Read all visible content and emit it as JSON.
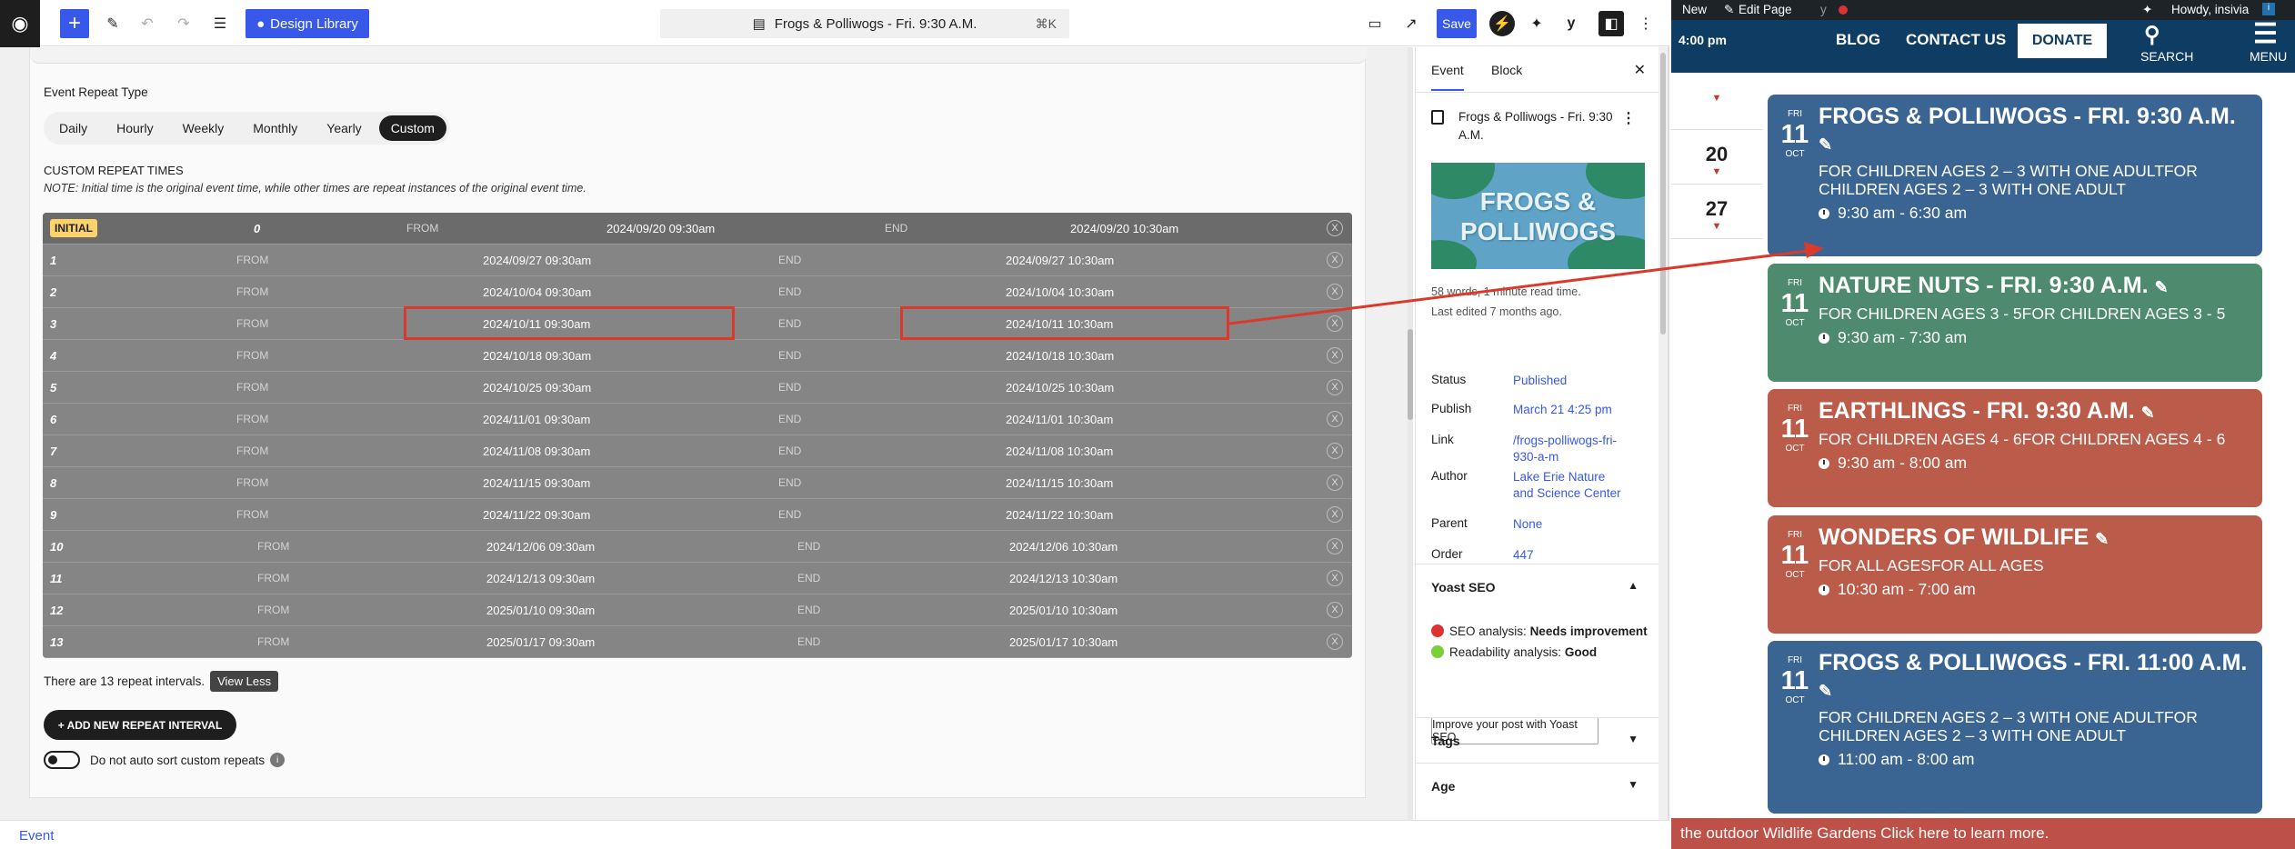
{
  "editor": {
    "design_library": "Design Library",
    "doc_title": "Frogs & Polliwogs - Fri. 9:30 A.M.",
    "doc_shortcut": "⌘K",
    "save_label": "Save",
    "breadcrumb": "Event"
  },
  "repeat": {
    "type_label": "Event Repeat Type",
    "types": [
      "Daily",
      "Hourly",
      "Weekly",
      "Monthly",
      "Yearly",
      "Custom"
    ],
    "active_type": "Custom",
    "custom_heading": "CUSTOM REPEAT TIMES",
    "note": "NOTE: Initial time is the original event time, while other times are repeat instances of the original event time.",
    "from_label": "FROM",
    "end_label": "END",
    "remove_label": "X",
    "initial": {
      "badge": "INITIAL",
      "num": "0",
      "from": "2024/09/20 09:30am",
      "end": "2024/09/20 10:30am"
    },
    "rows": [
      {
        "num": "1",
        "from": "2024/09/27 09:30am",
        "end": "2024/09/27 10:30am"
      },
      {
        "num": "2",
        "from": "2024/10/04 09:30am",
        "end": "2024/10/04 10:30am"
      },
      {
        "num": "3",
        "from": "2024/10/11 09:30am",
        "end": "2024/10/11 10:30am"
      },
      {
        "num": "4",
        "from": "2024/10/18 09:30am",
        "end": "2024/10/18 10:30am"
      },
      {
        "num": "5",
        "from": "2024/10/25 09:30am",
        "end": "2024/10/25 10:30am"
      },
      {
        "num": "6",
        "from": "2024/11/01 09:30am",
        "end": "2024/11/01 10:30am"
      },
      {
        "num": "7",
        "from": "2024/11/08 09:30am",
        "end": "2024/11/08 10:30am"
      },
      {
        "num": "8",
        "from": "2024/11/15 09:30am",
        "end": "2024/11/15 10:30am"
      },
      {
        "num": "9",
        "from": "2024/11/22 09:30am",
        "end": "2024/11/22 10:30am"
      },
      {
        "num": "10",
        "from": "2024/12/06 09:30am",
        "end": "2024/12/06 10:30am"
      },
      {
        "num": "11",
        "from": "2024/12/13 09:30am",
        "end": "2024/12/13 10:30am"
      },
      {
        "num": "12",
        "from": "2025/01/10 09:30am",
        "end": "2025/01/10 10:30am"
      },
      {
        "num": "13",
        "from": "2025/01/17 09:30am",
        "end": "2025/01/17 10:30am"
      }
    ],
    "count_text": "There are 13 repeat intervals.",
    "view_less": "View Less",
    "add_interval": "+ ADD NEW REPEAT INTERVAL",
    "no_sort_label": "Do not auto sort custom repeats",
    "info_glyph": "i",
    "highlight_color": "#d93a2b"
  },
  "sidebar": {
    "tab_event": "Event",
    "tab_block": "Block",
    "post_title": "Frogs & Polliwogs - Fri. 9:30 A.M.",
    "image_text": "FROGS & POLLIWOGS",
    "meta_words": "58 words, 1 minute read time.",
    "meta_edited": "Last edited 7 months ago.",
    "fields": [
      {
        "key": "Status",
        "value": "Published"
      },
      {
        "key": "Publish",
        "value": "March 21 4:25 pm"
      },
      {
        "key": "Link",
        "value": "/frogs-polliwogs-fri-930-a-m"
      },
      {
        "key": "Author",
        "value": "Lake Erie Nature and Science Center"
      },
      {
        "key": "Parent",
        "value": "None"
      },
      {
        "key": "Order",
        "value": "447"
      }
    ],
    "yoast_title": "Yoast SEO",
    "seo_label": "SEO analysis:",
    "seo_value": "Needs improvement",
    "read_label": "Readability analysis:",
    "read_value": "Good",
    "yoast_button": "Improve your post with Yoast SEO",
    "tags_title": "Tags",
    "age_title": "Age"
  },
  "site": {
    "admin_new": "New",
    "admin_edit": "Edit Page",
    "admin_howdy": "Howdy, insivia",
    "time_label": "4:00 pm",
    "nav": {
      "blog": "BLOG",
      "contact": "CONTACT US",
      "donate": "DONATE",
      "search": "SEARCH",
      "menu": "MENU"
    },
    "days": [
      "20",
      "27"
    ],
    "events": [
      {
        "dw": "FRI",
        "dn": "11",
        "dm": "OCT",
        "title": "Frogs & Polliwogs - Fri. 9:30 A.M.",
        "desc": "For children ages 2 – 3 with one adultFor children ages 2 – 3 with one adult",
        "time": "9:30 am - 6:30 am",
        "color": "#3a6491"
      },
      {
        "dw": "FRI",
        "dn": "11",
        "dm": "OCT",
        "title": "Nature Nuts - Fri. 9:30 A.M.",
        "desc": "For children ages 3 - 5For children ages 3 - 5",
        "time": "9:30 am - 7:30 am",
        "color": "#4e8a6d"
      },
      {
        "dw": "FRI",
        "dn": "11",
        "dm": "OCT",
        "title": "Earthlings - Fri. 9:30 A.M.",
        "desc": "For children ages 4 - 6For children ages 4 - 6",
        "time": "9:30 am - 8:00 am",
        "color": "#bb5b4a"
      },
      {
        "dw": "FRI",
        "dn": "11",
        "dm": "OCT",
        "title": "Wonders of Wildlife",
        "desc": "For all agesFor all ages",
        "time": "10:30 am - 7:00 am",
        "color": "#bb5b4a"
      },
      {
        "dw": "FRI",
        "dn": "11",
        "dm": "OCT",
        "title": "Frogs & Polliwogs - Fri. 11:00 A.M.",
        "desc": "For children ages 2 – 3 with one adultFor children ages 2 – 3 with one adult",
        "time": "11:00 am - 8:00 am",
        "color": "#3a6491"
      }
    ],
    "promo": "the outdoor Wildlife Gardens  Click here to learn more."
  }
}
